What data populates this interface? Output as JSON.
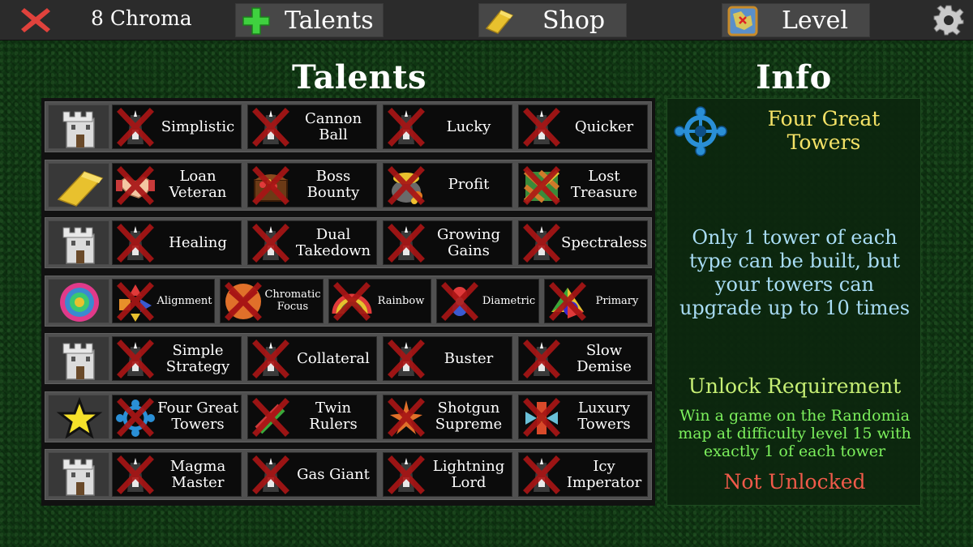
{
  "topbar": {
    "chroma": "8 Chroma",
    "talents_label": "Talents",
    "shop_label": "Shop",
    "level_label": "Level"
  },
  "headings": {
    "talents": "Talents",
    "info": "Info"
  },
  "colors": {
    "background": "#0f3512",
    "info_title": "#f4e266",
    "info_desc": "#a8dcf4",
    "req_title": "#c6ee74",
    "req_text": "#7cf05c",
    "status_locked": "#f05a4a",
    "locked_cross": "#b81818"
  },
  "rows": [
    {
      "icon": "castle-icon",
      "cells": [
        {
          "label": "Simplistic",
          "icon": "tower-icon"
        },
        {
          "label": "Cannon Ball",
          "icon": "tower-icon"
        },
        {
          "label": "Lucky",
          "icon": "tower-icon"
        },
        {
          "label": "Quicker",
          "icon": "tower-icon"
        }
      ]
    },
    {
      "icon": "gold-bar-icon",
      "cells": [
        {
          "label": "Loan Veteran",
          "icon": "handshake-icon"
        },
        {
          "label": "Boss Bounty",
          "icon": "treasure-chest-icon"
        },
        {
          "label": "Profit",
          "icon": "gold-pot-icon"
        },
        {
          "label": "Lost Treasure",
          "icon": "treasure-icon"
        }
      ]
    },
    {
      "icon": "castle-icon",
      "cells": [
        {
          "label": "Healing",
          "icon": "tower-icon"
        },
        {
          "label": "Dual Takedown",
          "icon": "tower-icon"
        },
        {
          "label": "Growing Gains",
          "icon": "tower-icon"
        },
        {
          "label": "Spectraless",
          "icon": "tower-icon"
        }
      ]
    },
    {
      "icon": "spiral-icon",
      "cells": [
        {
          "label": "Alignment",
          "icon": "shapes-icon"
        },
        {
          "label": "Chromatic Focus",
          "icon": "orb-icon"
        },
        {
          "label": "Rainbow",
          "icon": "rainbow-icon"
        },
        {
          "label": "Diametric",
          "icon": "diametric-icon"
        },
        {
          "label": "Primary",
          "icon": "primary-icon"
        }
      ]
    },
    {
      "icon": "castle-icon",
      "cells": [
        {
          "label": "Simple Strategy",
          "icon": "tower-icon"
        },
        {
          "label": "Collateral",
          "icon": "tower-icon"
        },
        {
          "label": "Buster",
          "icon": "tower-icon"
        },
        {
          "label": "Slow Demise",
          "icon": "tower-icon"
        }
      ]
    },
    {
      "icon": "star-icon",
      "cells": [
        {
          "label": "Four Great Towers",
          "icon": "four-towers-icon"
        },
        {
          "label": "Twin Rulers",
          "icon": "twin-rulers-icon"
        },
        {
          "label": "Shotgun Supreme",
          "icon": "shotgun-icon"
        },
        {
          "label": "Luxury Towers",
          "icon": "luxury-icon"
        }
      ]
    },
    {
      "icon": "castle-icon",
      "cells": [
        {
          "label": "Magma Master",
          "icon": "tower-icon"
        },
        {
          "label": "Gas Giant",
          "icon": "tower-icon"
        },
        {
          "label": "Lightning Lord",
          "icon": "tower-icon"
        },
        {
          "label": "Icy Imperator",
          "icon": "tower-icon"
        }
      ]
    }
  ],
  "info": {
    "icon": "four-towers-icon",
    "name": "Four Great Towers",
    "description": "Only 1 tower of each type can be built, but your towers can upgrade up to 10 times",
    "requirement_title": "Unlock Requirement",
    "requirement_text": "Win a game on the Randomia map at difficulty level 15 with exactly 1 of each tower",
    "status": "Not Unlocked"
  }
}
